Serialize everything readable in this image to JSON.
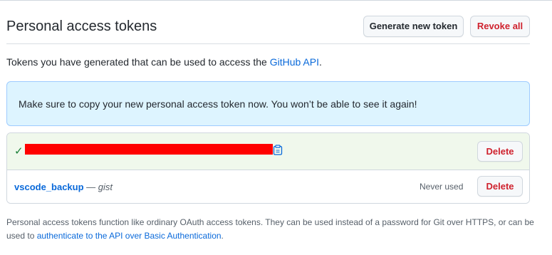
{
  "header": {
    "title": "Personal access tokens",
    "generate_label": "Generate new token",
    "revoke_label": "Revoke all"
  },
  "intro": {
    "text": "Tokens you have generated that can be used to access the ",
    "link": "GitHub API",
    "suffix": "."
  },
  "flash": {
    "message": "Make sure to copy your new personal access token now. You won’t be able to see it again!"
  },
  "tokens": [
    {
      "status_icon": "check-icon",
      "value": "",
      "redacted": true,
      "copy_icon": "clipboard-icon",
      "delete_label": "Delete"
    },
    {
      "name": "vscode_backup",
      "separator": " — ",
      "scope": "gist",
      "last_used": "Never used",
      "delete_label": "Delete"
    }
  ],
  "footer": {
    "text": "Personal access tokens function like ordinary OAuth access tokens. They can be used instead of a password for Git over HTTPS, or can be used to ",
    "link": "authenticate to the API over Basic Authentication",
    "suffix": "."
  },
  "colors": {
    "link": "#0969da",
    "danger": "#cf222e",
    "success": "#1a7f37",
    "flash_bg": "#ddf4ff",
    "new_token_bg": "#f0f8ec",
    "redaction": "#ff0000"
  }
}
